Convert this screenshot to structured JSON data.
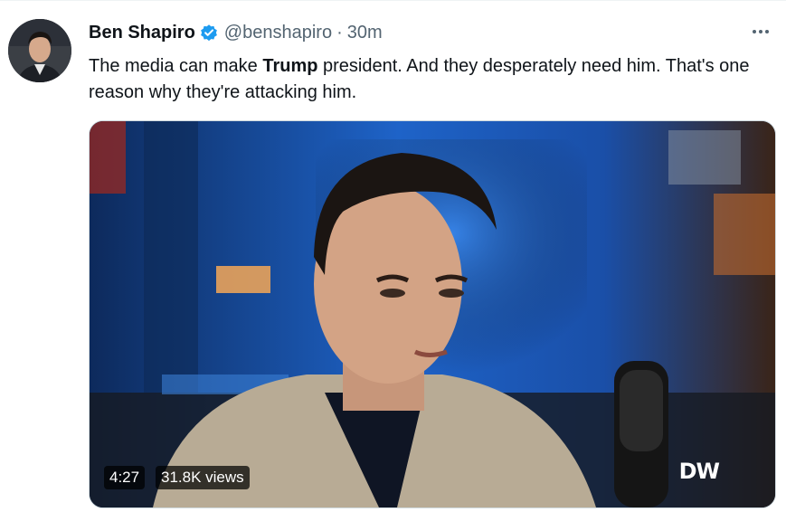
{
  "tweet": {
    "author_name": "Ben Shapiro",
    "handle": "@benshapiro",
    "separator": "·",
    "time": "30m",
    "text_before": "The media can make ",
    "text_bold": "Trump",
    "text_after": " president. And they desperately need him. That's one reason why they're attacking him.",
    "verified_color": "#1d9bf0",
    "more_icon": "more-horizontal-icon"
  },
  "video": {
    "duration": "4:27",
    "views": "31.8K views",
    "watermark": "DW",
    "backdrop_color": "#1f6fd6"
  }
}
